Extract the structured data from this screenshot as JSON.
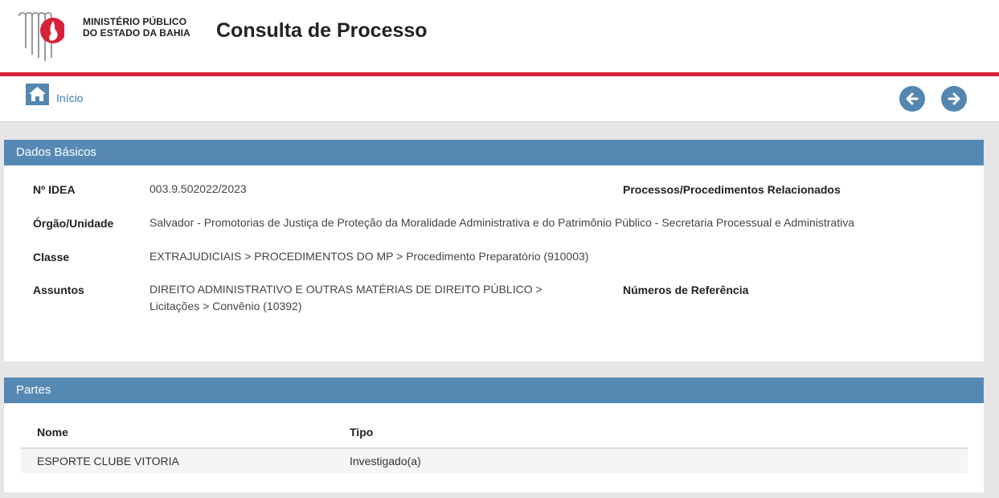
{
  "header": {
    "logo_line1": "MINISTÉRIO PÚBLICO",
    "logo_line2": "DO ESTADO DA BAHIA",
    "title": "Consulta de Processo",
    "accent_color": "#d6223c"
  },
  "nav": {
    "home_label": "Início",
    "home_icon": "home-icon",
    "back_icon": "arrow-left-icon",
    "forward_icon": "arrow-right-icon"
  },
  "dados_basicos": {
    "heading": "Dados Básicos",
    "idea_label": "Nº IDEA",
    "idea_value": "003.9.502022/2023",
    "orgao_label": "Órgão/Unidade",
    "orgao_value": "Salvador - Promotorias de Justiça de Proteção da Moralidade Administrativa e do Patrimônio Público - Secretaria Processual e Administrativa",
    "classe_label": "Classe",
    "classe_value": "EXTRAJUDICIAIS > PROCEDIMENTOS DO MP > Procedimento Preparatório (910003)",
    "assuntos_label": "Assuntos",
    "assuntos_line1": "DIREITO ADMINISTRATIVO E OUTRAS MATÉRIAS DE DIREITO PÚBLICO >",
    "assuntos_line2": "Licitações > Convênio (10392)",
    "relacionados_label": "Processos/Procedimentos Relacionados",
    "referencia_label": "Números de Referência"
  },
  "partes": {
    "heading": "Partes",
    "columns": [
      "Nome",
      "Tipo"
    ],
    "rows": [
      {
        "nome": "ESPORTE CLUBE VITORIA",
        "tipo": "Investigado(a)"
      }
    ]
  },
  "colors": {
    "panel_header": "#5589b3",
    "nav_button": "#5487b0",
    "link": "#3b7bb4"
  }
}
